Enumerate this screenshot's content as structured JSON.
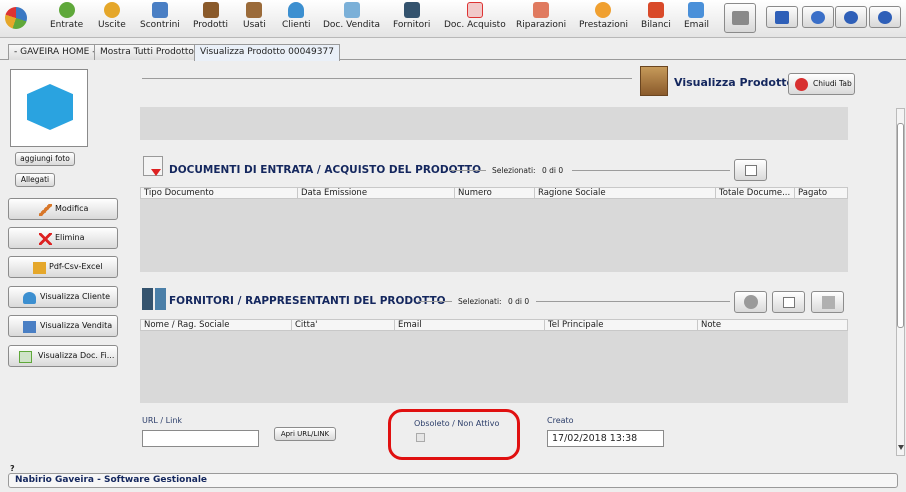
{
  "toolbar": {
    "items": [
      "Entrate",
      "Uscite",
      "Scontrini",
      "Prodotti",
      "Usati",
      "Clienti",
      "Doc. Vendita",
      "Fornitori",
      "Doc. Acquisto",
      "Riparazioni",
      "Prestazioni",
      "Bilanci",
      "Email"
    ],
    "colors": {
      "entrate": "#5fa83a",
      "uscite": "#e5a72a",
      "scontrini": "#4a7fc4",
      "prodotti": "#8a5a2b",
      "usati": "#9b6b3a",
      "clienti": "#3c8fd0",
      "doc_vendita": "#7bb0d8",
      "fornitori": "#34536e",
      "doc_acquisto": "#d33",
      "riparazioni": "#e07a5f",
      "prestazioni": "#f0a030",
      "bilanci": "#d94a2a",
      "email": "#4a90d9"
    }
  },
  "tabs": [
    "- GAVEIRA HOME -",
    "Mostra Tutti Prodotto",
    "Visualizza Prodotto 00049377"
  ],
  "sidebar": {
    "add_photo": "aggiungi foto",
    "attachments": "Allegati",
    "actions": [
      "Modifica",
      "Elimina",
      "Pdf-Csv-Excel",
      "Visualizza Cliente",
      "Visualizza Vendita",
      "Visualizza Doc. Fi..."
    ]
  },
  "header": {
    "title": "Visualizza Prodotto",
    "close_tab": "Chiudi Tab"
  },
  "documents": {
    "title": "DOCUMENTI DI ENTRATA / ACQUISTO DEL PRODOTTO",
    "selected_label": "Selezionati:",
    "selected_value": "0 di 0",
    "columns": [
      "Tipo Documento",
      "Data Emissione",
      "Numero",
      "Ragione Sociale",
      "Totale Docume...",
      "Pagato"
    ]
  },
  "suppliers": {
    "title": "FORNITORI / RAPPRESENTANTI DEL PRODOTTO",
    "selected_label": "Selezionati:",
    "selected_value": "0 di 0",
    "columns": [
      "Nome / Rag. Sociale",
      "Citta'",
      "Email",
      "Tel Principale",
      "Note"
    ]
  },
  "url": {
    "label": "URL / Link",
    "value": "",
    "button": "Apri URL/LINK"
  },
  "obsolete": {
    "label": "Obsoleto / Non Attivo",
    "checked": false,
    "highlight_color": "#e01010"
  },
  "created": {
    "label": "Creato",
    "value": "17/02/2018 13:38"
  },
  "footer": {
    "help": "?",
    "status": "Nabirio Gaveira - Software Gestionale"
  }
}
